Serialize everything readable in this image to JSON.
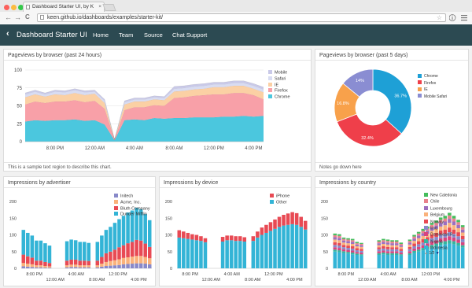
{
  "browser": {
    "tab_title": "Dashboard Starter UI, by K",
    "tab_close": "×",
    "url": "keen.github.io/dashboards/examples/starter-kit/",
    "back_glyph": "←",
    "forward_glyph": "→",
    "reload_glyph": "C",
    "bookmark_glyph": "☆",
    "colors": {
      "close": "#fc605c",
      "minimize": "#fcbb40",
      "zoom": "#34c84a"
    }
  },
  "app": {
    "back_glyph": "‹",
    "title": "Dashboard Starter UI",
    "nav": [
      "Home",
      "Team",
      "Source",
      "Chat Support"
    ],
    "bar_color": "#2c4a52"
  },
  "panels": {
    "pageviews_24h": {
      "title": "Pageviews by browser (past 24 hours)",
      "note": "This is a sample text region to describe this chart."
    },
    "pageviews_5d": {
      "title": "Pageviews by browser (past 5 days)",
      "note": "Notes go down here"
    },
    "advertiser": {
      "title": "Impressions by advertiser"
    },
    "device": {
      "title": "Impressions by device"
    },
    "country": {
      "title": "Impressions by country",
      "pager": "1/2",
      "pager_up": "▲",
      "pager_down": "▼"
    }
  },
  "chart_data": [
    {
      "id": "pageviews_24h",
      "type": "area",
      "stacked": true,
      "title": "Pageviews by browser (past 24 hours)",
      "x": [
        0,
        1,
        2,
        3,
        4,
        5,
        6,
        7,
        8,
        9,
        10,
        11,
        12,
        13,
        14,
        15,
        16,
        17,
        18,
        19,
        20,
        21,
        22,
        23,
        24
      ],
      "xtick_labels": [
        "8:00 PM",
        "12:00 AM",
        "4:00 AM",
        "8:00 AM",
        "12:00 PM",
        "4:00 PM"
      ],
      "xtick_positions": [
        3,
        7,
        11,
        15,
        19,
        23
      ],
      "ylim": [
        0,
        100
      ],
      "yticks": [
        0,
        25,
        50,
        75,
        100
      ],
      "grid": true,
      "legend": "right",
      "series": [
        {
          "name": "Chrome",
          "color": "#4bc7de",
          "values": [
            28,
            30,
            29,
            30,
            30,
            31,
            29,
            30,
            24,
            2,
            30,
            31,
            30,
            33,
            32,
            33,
            33,
            34,
            34,
            34,
            35,
            35,
            36,
            35,
            36
          ]
        },
        {
          "name": "Firefox",
          "color": "#f8a0a8",
          "values": [
            24,
            26,
            25,
            26,
            26,
            27,
            26,
            27,
            22,
            1,
            14,
            17,
            18,
            18,
            18,
            28,
            29,
            30,
            31,
            32,
            31,
            33,
            32,
            30,
            23
          ]
        },
        {
          "name": "IE",
          "color": "#fbd0a4",
          "values": [
            10,
            10,
            9,
            10,
            9,
            10,
            10,
            10,
            8,
            0,
            8,
            8,
            8,
            8,
            8,
            9,
            9,
            9,
            9,
            10,
            10,
            10,
            10,
            9,
            10
          ]
        },
        {
          "name": "Safari",
          "color": "#d8dcf2",
          "values": [
            4,
            4,
            3,
            4,
            4,
            4,
            4,
            3,
            3,
            0,
            3,
            3,
            3,
            3,
            3,
            4,
            4,
            4,
            4,
            4,
            4,
            4,
            4,
            4,
            4
          ]
        },
        {
          "name": "Mobile",
          "color": "#c9c9e8",
          "values": [
            2,
            2,
            2,
            2,
            2,
            2,
            2,
            2,
            2,
            0,
            2,
            2,
            2,
            2,
            2,
            3,
            3,
            3,
            3,
            3,
            3,
            3,
            3,
            3,
            3
          ]
        }
      ]
    },
    {
      "id": "pageviews_5d",
      "type": "pie",
      "donut": true,
      "title": "Pageviews by browser (past 5 days)",
      "legend": "right",
      "series": [
        {
          "name": "Chrome",
          "color": "#1ea0d6",
          "value": 36.7,
          "label": "36.7%"
        },
        {
          "name": "Firefox",
          "color": "#ef3f4a",
          "value": 32.4,
          "label": "32.4%"
        },
        {
          "name": "IE",
          "color": "#f8a14b",
          "value": 16.8,
          "label": "16.8%"
        },
        {
          "name": "Mobile Safari",
          "color": "#8a8dd2",
          "value": 14.1,
          "label": "14%"
        }
      ]
    },
    {
      "id": "advertiser",
      "type": "bar",
      "stacked": true,
      "title": "Impressions by advertiser",
      "ylim": [
        0,
        200
      ],
      "yticks": [
        0,
        50,
        100,
        150,
        200
      ],
      "xtick_labels": [
        "8:00 PM",
        "12:00 AM",
        "4:00 AM",
        "8:00 AM",
        "12:00 PM",
        "4:00 PM"
      ],
      "legend": "top-right",
      "series": [
        {
          "name": "Initech",
          "color": "#8889c9",
          "values": [
            6,
            5,
            4,
            3,
            3,
            2,
            2,
            0,
            0,
            0,
            3,
            4,
            4,
            3,
            3,
            3,
            0,
            3,
            5,
            7,
            8,
            9,
            10,
            12,
            13,
            14,
            15,
            15,
            14,
            12
          ]
        },
        {
          "name": "Acme, Inc.",
          "color": "#fab27b",
          "values": [
            10,
            9,
            8,
            6,
            6,
            5,
            4,
            0,
            0,
            0,
            6,
            7,
            7,
            6,
            6,
            6,
            0,
            6,
            9,
            12,
            14,
            15,
            17,
            19,
            20,
            21,
            22,
            22,
            20,
            18
          ]
        },
        {
          "name": "Bluth Company",
          "color": "#e84a54",
          "values": [
            25,
            22,
            20,
            14,
            14,
            12,
            10,
            0,
            0,
            0,
            14,
            15,
            15,
            14,
            14,
            13,
            0,
            14,
            20,
            26,
            28,
            32,
            36,
            38,
            42,
            44,
            48,
            46,
            40,
            34
          ]
        },
        {
          "name": "Dunder Mifflin",
          "color": "#33b4d6",
          "values": [
            74,
            70,
            66,
            60,
            60,
            56,
            52,
            0,
            0,
            0,
            58,
            60,
            58,
            56,
            56,
            54,
            0,
            56,
            64,
            70,
            74,
            80,
            84,
            88,
            92,
            94,
            96,
            94,
            88,
            80
          ]
        }
      ]
    },
    {
      "id": "device",
      "type": "bar",
      "stacked": true,
      "title": "Impressions by device",
      "ylim": [
        0,
        200
      ],
      "yticks": [
        0,
        50,
        100,
        150,
        200
      ],
      "xtick_labels": [
        "8:00 PM",
        "12:00 AM",
        "4:00 AM",
        "8:00 AM",
        "12:00 PM",
        "4:00 PM"
      ],
      "legend": "top-right",
      "series": [
        {
          "name": "Other",
          "color": "#33b4d6",
          "values": [
            92,
            90,
            88,
            86,
            84,
            82,
            78,
            0,
            0,
            0,
            80,
            84,
            84,
            82,
            82,
            80,
            0,
            82,
            92,
            100,
            106,
            112,
            118,
            124,
            128,
            130,
            132,
            130,
            124,
            116
          ]
        },
        {
          "name": "iPhone",
          "color": "#e84a54",
          "values": [
            22,
            20,
            18,
            16,
            16,
            14,
            12,
            0,
            0,
            0,
            14,
            14,
            14,
            14,
            14,
            13,
            0,
            14,
            18,
            22,
            24,
            26,
            28,
            30,
            32,
            34,
            36,
            35,
            30,
            26
          ]
        }
      ]
    },
    {
      "id": "country",
      "type": "bar",
      "stacked": true,
      "title": "Impressions by country",
      "ylim": [
        0,
        200
      ],
      "yticks": [
        0,
        50,
        100,
        150,
        200
      ],
      "xtick_labels": [
        "8:00 PM",
        "12:00 AM",
        "4:00 AM",
        "8:00 AM",
        "12:00 PM",
        "4:00 PM"
      ],
      "legend": "top-right",
      "series": [
        {
          "name": "Indonesia",
          "color": "#33b4d6",
          "values": [
            50,
            48,
            46,
            44,
            42,
            40,
            38,
            0,
            0,
            0,
            40,
            42,
            40,
            40,
            40,
            38,
            0,
            40,
            46,
            50,
            54,
            58,
            62,
            66,
            70,
            72,
            74,
            72,
            68,
            62
          ]
        },
        {
          "name": "Nigeria",
          "color": "#35b59f",
          "values": [
            6,
            6,
            5,
            5,
            5,
            4,
            4,
            0,
            0,
            0,
            5,
            5,
            5,
            5,
            5,
            4,
            0,
            5,
            6,
            6,
            7,
            7,
            8,
            8,
            9,
            9,
            10,
            9,
            8,
            7
          ]
        },
        {
          "name": "Dominican R...",
          "color": "#d8447e",
          "values": [
            7,
            7,
            6,
            6,
            6,
            5,
            5,
            0,
            0,
            0,
            6,
            6,
            6,
            6,
            6,
            5,
            0,
            6,
            7,
            8,
            8,
            9,
            10,
            10,
            11,
            11,
            12,
            11,
            10,
            9
          ]
        },
        {
          "name": "Iraq",
          "color": "#8889c9",
          "values": [
            7,
            7,
            6,
            6,
            6,
            5,
            5,
            0,
            0,
            0,
            6,
            6,
            6,
            6,
            6,
            5,
            0,
            6,
            7,
            8,
            8,
            9,
            10,
            10,
            11,
            11,
            12,
            11,
            10,
            9
          ]
        },
        {
          "name": "Norway",
          "color": "#e84a54",
          "values": [
            8,
            8,
            7,
            7,
            7,
            6,
            6,
            0,
            0,
            0,
            6,
            7,
            7,
            6,
            6,
            6,
            0,
            7,
            8,
            9,
            10,
            10,
            11,
            12,
            12,
            13,
            14,
            13,
            12,
            10
          ]
        },
        {
          "name": "Belgium",
          "color": "#fab27b",
          "values": [
            8,
            8,
            7,
            7,
            7,
            6,
            6,
            0,
            0,
            0,
            6,
            7,
            7,
            6,
            6,
            6,
            0,
            7,
            8,
            9,
            10,
            10,
            11,
            12,
            12,
            13,
            14,
            13,
            12,
            10
          ]
        },
        {
          "name": "Luxembourg",
          "color": "#9c6fbe",
          "values": [
            7,
            7,
            6,
            6,
            6,
            5,
            5,
            0,
            0,
            0,
            6,
            6,
            6,
            6,
            6,
            5,
            0,
            6,
            7,
            8,
            8,
            9,
            10,
            10,
            11,
            11,
            12,
            11,
            10,
            9
          ]
        },
        {
          "name": "Chile",
          "color": "#e8828c",
          "values": [
            6,
            6,
            5,
            5,
            5,
            4,
            4,
            0,
            0,
            0,
            5,
            5,
            5,
            5,
            5,
            4,
            0,
            5,
            6,
            6,
            7,
            7,
            8,
            8,
            9,
            9,
            10,
            9,
            8,
            7
          ]
        },
        {
          "name": "New Caledonia",
          "color": "#44bd5c",
          "values": [
            5,
            5,
            4,
            4,
            4,
            4,
            3,
            0,
            0,
            0,
            4,
            4,
            4,
            4,
            4,
            4,
            0,
            4,
            5,
            5,
            6,
            6,
            6,
            7,
            7,
            8,
            8,
            8,
            7,
            6
          ]
        }
      ]
    }
  ]
}
